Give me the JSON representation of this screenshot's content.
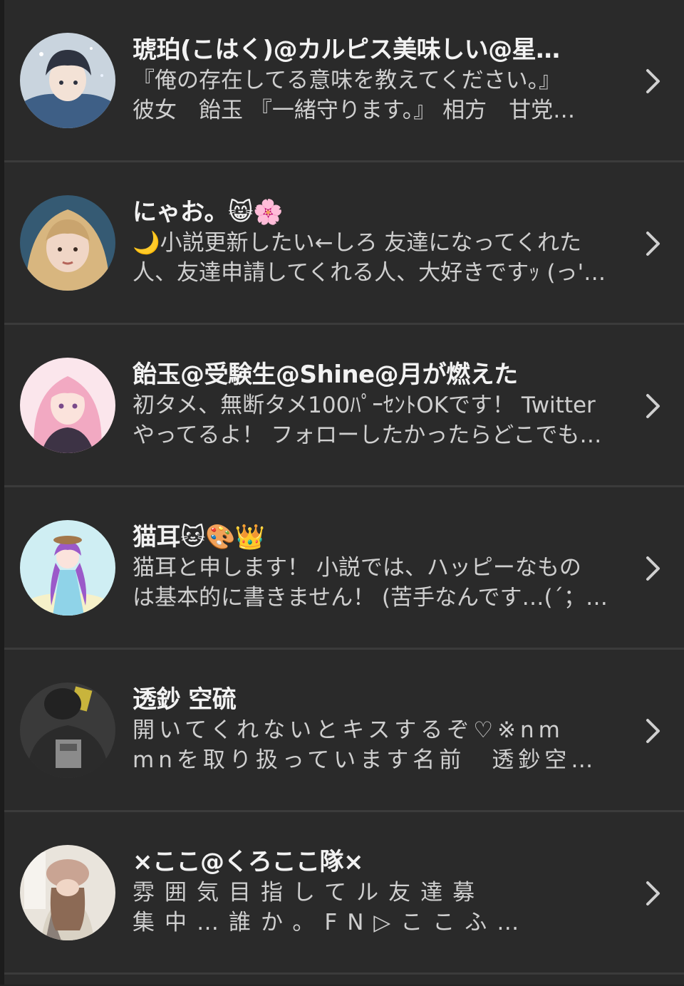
{
  "users": [
    {
      "name": "琥珀(こはく)@カルピス美味しい@星…",
      "desc_line1": "『俺の存在してる意味を教えてください。』",
      "desc_line2": "彼女　飴玉 『一緒守ります。』 相方　甘党…",
      "avatar_icon": "avatar-anime-boy-icon",
      "colors": {
        "bg": "#c9d4de",
        "hair": "#2e3340",
        "cloth": "#3e5f86"
      }
    },
    {
      "name": "にゃお。😸🌸",
      "desc_line1": "🌙小説更新したい←しろ 友達になってくれた",
      "desc_line2": "人、友達申請してくれる人、大好きですｯ (っ'…",
      "avatar_icon": "avatar-hooded-person-icon",
      "colors": {
        "bg": "#355a73",
        "hair": "#c9a46e",
        "cloth": "#d8b67f"
      }
    },
    {
      "name": "飴玉@受験生@Shine@月が燃えた",
      "desc_line1": "初タメ、無断タメ100ﾊﾟｰｾﾝﾄOKです！ Twitter",
      "desc_line2": "やってるよ！ フォローしたかったらどこでも…",
      "avatar_icon": "avatar-pink-hair-girl-icon",
      "colors": {
        "bg": "#fbe6ec",
        "hair": "#f2a9c2",
        "cloth": "#3d3345"
      }
    },
    {
      "name": "猫耳🐱🎨👑",
      "desc_line1": "猫耳と申します！ 小説では、ハッピーなもの",
      "desc_line2": "は基本的に書きません！ (苦手なんです…(´；…",
      "avatar_icon": "avatar-purple-hair-girl-icon",
      "colors": {
        "bg": "#cfeef3",
        "hair": "#9b59c9",
        "cloth": "#8fd3e8"
      }
    },
    {
      "name": "透鈔 空硫",
      "desc_line1": "開いてくれないとキスするぞ♡※nm",
      "desc_line2": "mnを取り扱っています名前　透鈔空…",
      "avatar_icon": "avatar-dark-shirt-person-icon",
      "colors": {
        "bg": "#3a3a3a",
        "hair": "#222222",
        "cloth": "#2b2b2b"
      }
    },
    {
      "name": "×ここ@くろここ隊×",
      "desc_line1": "雰囲気目指してル友達募",
      "desc_line2": "集中…誰か。FN▷ここふ…",
      "avatar_icon": "avatar-beret-girl-icon",
      "colors": {
        "bg": "#e9e4dc",
        "hair": "#8c6a55",
        "cloth": "#d9d2c4"
      }
    }
  ]
}
